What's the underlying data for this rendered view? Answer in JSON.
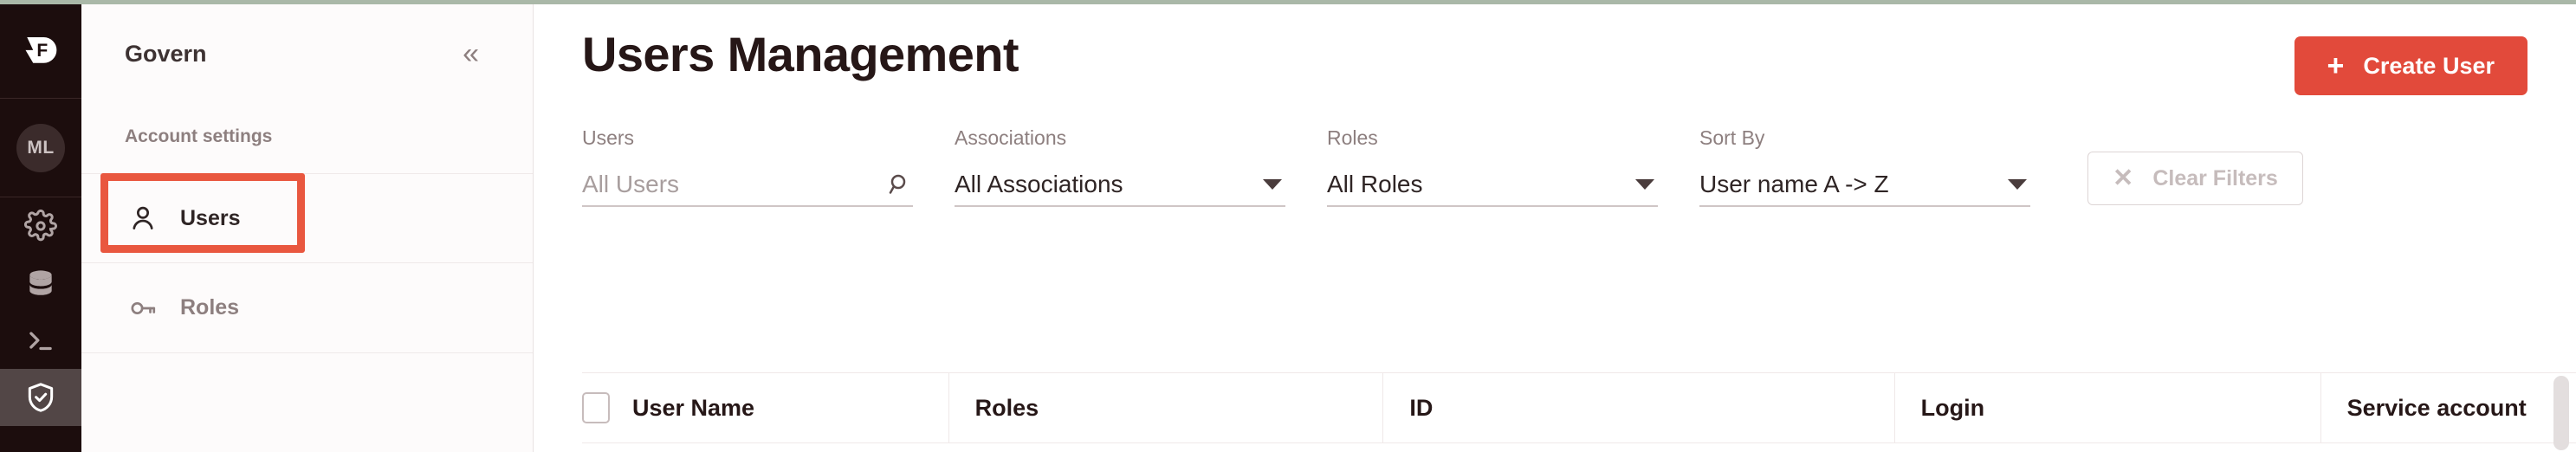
{
  "window": {
    "top_strip_color": "#aab8a8",
    "accent_color": "#e24a3b",
    "annotation_color": "#e9573f"
  },
  "rail": {
    "items": [
      {
        "name": "app-logo",
        "icon": "dremio-logo-icon",
        "label": "F",
        "active": false
      },
      {
        "name": "account-avatar",
        "icon": "avatar-icon",
        "label": "ML",
        "active": false
      },
      {
        "name": "settings",
        "icon": "gear-icon",
        "label": "",
        "active": false
      },
      {
        "name": "datasets",
        "icon": "database-icon",
        "label": "",
        "active": false
      },
      {
        "name": "sql-runner",
        "icon": "terminal-icon",
        "label": "",
        "active": false
      },
      {
        "name": "govern",
        "icon": "shield-check-icon",
        "label": "",
        "active": true
      }
    ]
  },
  "sidebar": {
    "title": "Govern",
    "collapse_icon": "«",
    "section_label": "Account settings",
    "items": [
      {
        "label": "Users",
        "icon": "person-icon",
        "current": true
      },
      {
        "label": "Roles",
        "icon": "key-icon",
        "current": false
      }
    ]
  },
  "header": {
    "title": "Users Management",
    "create_button": {
      "label": "Create User",
      "plus": "+"
    }
  },
  "filters": [
    {
      "label": "Users",
      "value": "All Users",
      "is_placeholder": true,
      "control": "search",
      "icon": "search-icon"
    },
    {
      "label": "Associations",
      "value": "All Associations",
      "is_placeholder": false,
      "control": "select",
      "icon": "chevron-down-icon"
    },
    {
      "label": "Roles",
      "value": "All Roles",
      "is_placeholder": false,
      "control": "select",
      "icon": "chevron-down-icon"
    },
    {
      "label": "Sort By",
      "value": "User name A -> Z",
      "is_placeholder": false,
      "control": "select",
      "icon": "chevron-down-icon"
    }
  ],
  "clear_filters": {
    "label": "Clear Filters",
    "icon": "close-icon",
    "glyph": "✕"
  },
  "table": {
    "columns": [
      "User Name",
      "Roles",
      "ID",
      "Login",
      "Service account"
    ],
    "rows": []
  }
}
